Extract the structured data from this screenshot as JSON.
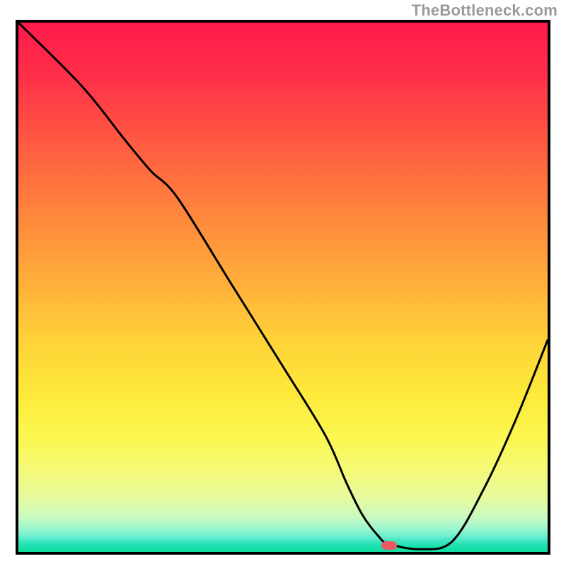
{
  "watermark": "TheBottleneck.com",
  "chart_data": {
    "type": "line",
    "title": "",
    "xlabel": "",
    "ylabel": "",
    "xlim": [
      0,
      100
    ],
    "ylim": [
      0,
      100
    ],
    "grid": false,
    "series": [
      {
        "name": "curve",
        "x": [
          0,
          12,
          20,
          25,
          30,
          40,
          50,
          58,
          62,
          65,
          68,
          70,
          76,
          82,
          88,
          94,
          100
        ],
        "y": [
          100,
          88,
          78,
          72,
          67,
          51,
          35,
          22,
          13,
          7,
          3,
          1.5,
          0.5,
          2,
          12,
          25,
          40
        ]
      }
    ],
    "marker": {
      "x": 70,
      "y": 1.2
    },
    "background_gradient": {
      "top": "#ff1a4b",
      "mid": "#fde93a",
      "bottom": "#0fde9f"
    }
  }
}
